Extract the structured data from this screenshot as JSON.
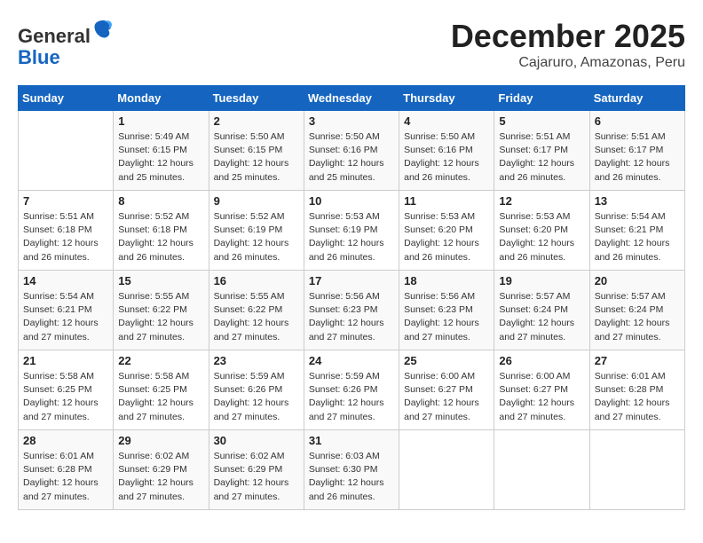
{
  "header": {
    "logo_line1": "General",
    "logo_line2": "Blue",
    "month": "December 2025",
    "location": "Cajaruro, Amazonas, Peru"
  },
  "days_of_week": [
    "Sunday",
    "Monday",
    "Tuesday",
    "Wednesday",
    "Thursday",
    "Friday",
    "Saturday"
  ],
  "weeks": [
    [
      {
        "day": "",
        "info": ""
      },
      {
        "day": "1",
        "info": "Sunrise: 5:49 AM\nSunset: 6:15 PM\nDaylight: 12 hours\nand 25 minutes."
      },
      {
        "day": "2",
        "info": "Sunrise: 5:50 AM\nSunset: 6:15 PM\nDaylight: 12 hours\nand 25 minutes."
      },
      {
        "day": "3",
        "info": "Sunrise: 5:50 AM\nSunset: 6:16 PM\nDaylight: 12 hours\nand 25 minutes."
      },
      {
        "day": "4",
        "info": "Sunrise: 5:50 AM\nSunset: 6:16 PM\nDaylight: 12 hours\nand 26 minutes."
      },
      {
        "day": "5",
        "info": "Sunrise: 5:51 AM\nSunset: 6:17 PM\nDaylight: 12 hours\nand 26 minutes."
      },
      {
        "day": "6",
        "info": "Sunrise: 5:51 AM\nSunset: 6:17 PM\nDaylight: 12 hours\nand 26 minutes."
      }
    ],
    [
      {
        "day": "7",
        "info": "Sunrise: 5:51 AM\nSunset: 6:18 PM\nDaylight: 12 hours\nand 26 minutes."
      },
      {
        "day": "8",
        "info": "Sunrise: 5:52 AM\nSunset: 6:18 PM\nDaylight: 12 hours\nand 26 minutes."
      },
      {
        "day": "9",
        "info": "Sunrise: 5:52 AM\nSunset: 6:19 PM\nDaylight: 12 hours\nand 26 minutes."
      },
      {
        "day": "10",
        "info": "Sunrise: 5:53 AM\nSunset: 6:19 PM\nDaylight: 12 hours\nand 26 minutes."
      },
      {
        "day": "11",
        "info": "Sunrise: 5:53 AM\nSunset: 6:20 PM\nDaylight: 12 hours\nand 26 minutes."
      },
      {
        "day": "12",
        "info": "Sunrise: 5:53 AM\nSunset: 6:20 PM\nDaylight: 12 hours\nand 26 minutes."
      },
      {
        "day": "13",
        "info": "Sunrise: 5:54 AM\nSunset: 6:21 PM\nDaylight: 12 hours\nand 26 minutes."
      }
    ],
    [
      {
        "day": "14",
        "info": "Sunrise: 5:54 AM\nSunset: 6:21 PM\nDaylight: 12 hours\nand 27 minutes."
      },
      {
        "day": "15",
        "info": "Sunrise: 5:55 AM\nSunset: 6:22 PM\nDaylight: 12 hours\nand 27 minutes."
      },
      {
        "day": "16",
        "info": "Sunrise: 5:55 AM\nSunset: 6:22 PM\nDaylight: 12 hours\nand 27 minutes."
      },
      {
        "day": "17",
        "info": "Sunrise: 5:56 AM\nSunset: 6:23 PM\nDaylight: 12 hours\nand 27 minutes."
      },
      {
        "day": "18",
        "info": "Sunrise: 5:56 AM\nSunset: 6:23 PM\nDaylight: 12 hours\nand 27 minutes."
      },
      {
        "day": "19",
        "info": "Sunrise: 5:57 AM\nSunset: 6:24 PM\nDaylight: 12 hours\nand 27 minutes."
      },
      {
        "day": "20",
        "info": "Sunrise: 5:57 AM\nSunset: 6:24 PM\nDaylight: 12 hours\nand 27 minutes."
      }
    ],
    [
      {
        "day": "21",
        "info": "Sunrise: 5:58 AM\nSunset: 6:25 PM\nDaylight: 12 hours\nand 27 minutes."
      },
      {
        "day": "22",
        "info": "Sunrise: 5:58 AM\nSunset: 6:25 PM\nDaylight: 12 hours\nand 27 minutes."
      },
      {
        "day": "23",
        "info": "Sunrise: 5:59 AM\nSunset: 6:26 PM\nDaylight: 12 hours\nand 27 minutes."
      },
      {
        "day": "24",
        "info": "Sunrise: 5:59 AM\nSunset: 6:26 PM\nDaylight: 12 hours\nand 27 minutes."
      },
      {
        "day": "25",
        "info": "Sunrise: 6:00 AM\nSunset: 6:27 PM\nDaylight: 12 hours\nand 27 minutes."
      },
      {
        "day": "26",
        "info": "Sunrise: 6:00 AM\nSunset: 6:27 PM\nDaylight: 12 hours\nand 27 minutes."
      },
      {
        "day": "27",
        "info": "Sunrise: 6:01 AM\nSunset: 6:28 PM\nDaylight: 12 hours\nand 27 minutes."
      }
    ],
    [
      {
        "day": "28",
        "info": "Sunrise: 6:01 AM\nSunset: 6:28 PM\nDaylight: 12 hours\nand 27 minutes."
      },
      {
        "day": "29",
        "info": "Sunrise: 6:02 AM\nSunset: 6:29 PM\nDaylight: 12 hours\nand 27 minutes."
      },
      {
        "day": "30",
        "info": "Sunrise: 6:02 AM\nSunset: 6:29 PM\nDaylight: 12 hours\nand 27 minutes."
      },
      {
        "day": "31",
        "info": "Sunrise: 6:03 AM\nSunset: 6:30 PM\nDaylight: 12 hours\nand 26 minutes."
      },
      {
        "day": "",
        "info": ""
      },
      {
        "day": "",
        "info": ""
      },
      {
        "day": "",
        "info": ""
      }
    ]
  ]
}
